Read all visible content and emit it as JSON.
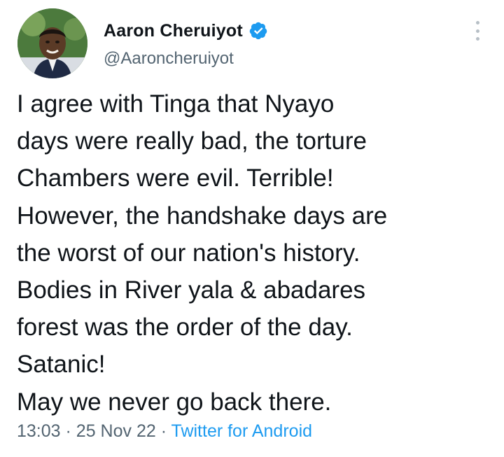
{
  "author": {
    "display_name": "Aaron Cheruiyot",
    "handle": "@Aaroncheruiyot",
    "verified": true,
    "avatar_icon": "profile-photo"
  },
  "tweet": {
    "lines": [
      "I agree with Tinga that Nyayo",
      "days were really bad, the torture",
      "Chambers were evil. Terrible!",
      "However, the handshake days are",
      "the worst of our nation's history.",
      "Bodies in River yala & abadares",
      "forest was the order of the day.",
      "Satanic!",
      "May we never go back there."
    ],
    "time": "13:03",
    "separator": "·",
    "date": "25 Nov 22",
    "source": "Twitter for Android"
  },
  "colors": {
    "verified_badge": "#1d9bf0",
    "source_link": "#1d9bf0",
    "secondary_text": "#536471"
  }
}
